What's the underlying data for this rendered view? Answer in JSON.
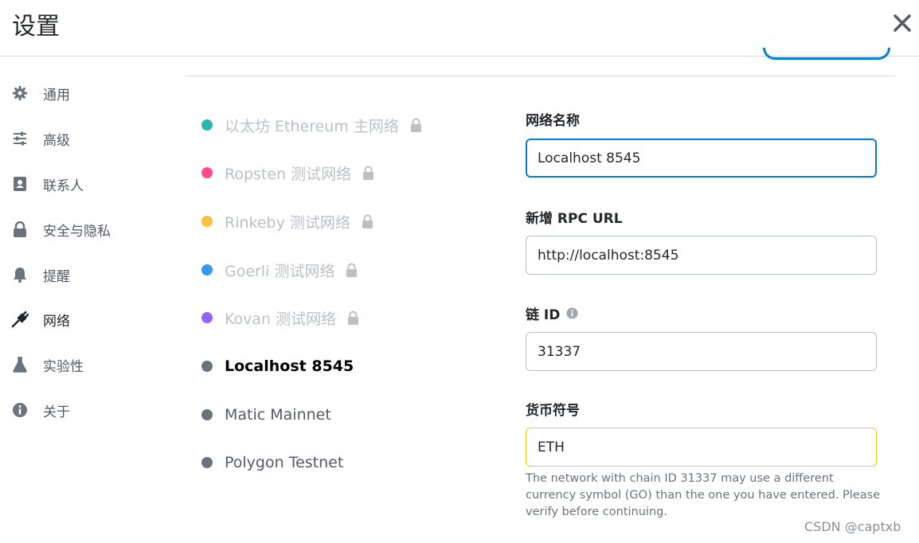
{
  "header": {
    "title": "设置",
    "close_icon": "close-icon"
  },
  "sidebar": {
    "items": [
      {
        "label": "通用",
        "icon": "gear-icon"
      },
      {
        "label": "高级",
        "icon": "sliders-icon"
      },
      {
        "label": "联系人",
        "icon": "contact-book-icon"
      },
      {
        "label": "安全与隐私",
        "icon": "lock-icon"
      },
      {
        "label": "提醒",
        "icon": "bell-icon"
      },
      {
        "label": "网络",
        "icon": "plug-icon",
        "active": true
      },
      {
        "label": "实验性",
        "icon": "flask-icon"
      },
      {
        "label": "关于",
        "icon": "info-icon"
      }
    ]
  },
  "networks": [
    {
      "label": "以太坊 Ethereum 主网络",
      "color": "#29b6af",
      "locked": true
    },
    {
      "label": "Ropsten 测试网络",
      "color": "#ff4a8d",
      "locked": true
    },
    {
      "label": "Rinkeby 测试网络",
      "color": "#f6c343",
      "locked": true
    },
    {
      "label": "Goerli 测试网络",
      "color": "#3099f2",
      "locked": true
    },
    {
      "label": "Kovan 测试网络",
      "color": "#9064ff",
      "locked": true
    },
    {
      "label": "Localhost 8545",
      "color": "#6a737d",
      "locked": false,
      "selected": true
    },
    {
      "label": "Matic Mainnet",
      "color": "#6a737d",
      "locked": false
    },
    {
      "label": "Polygon Testnet",
      "color": "#6a737d",
      "locked": false
    }
  ],
  "form": {
    "network_name_label": "网络名称",
    "network_name_value": "Localhost 8545",
    "rpc_url_label": "新增 RPC URL",
    "rpc_url_value": "http://localhost:8545",
    "chain_id_label": "链 ID",
    "chain_id_value": "31337",
    "currency_label": "货币符号",
    "currency_value": "ETH",
    "currency_warning": "The network with chain ID 31337 may use a different currency symbol (GO) than the one you have entered. Please verify before continuing."
  },
  "watermark": "CSDN @captxb",
  "colors": {
    "accent": "#037dd6",
    "warning_border": "#f5c917",
    "muted_text": "#bbc0c5"
  }
}
